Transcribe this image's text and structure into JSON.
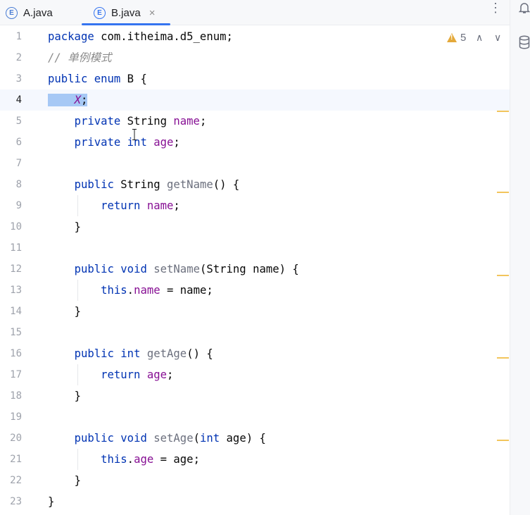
{
  "tabs": [
    {
      "label": "A.java",
      "icon": "E",
      "active": false
    },
    {
      "label": "B.java",
      "icon": "E",
      "active": true,
      "close": "×"
    }
  ],
  "toolbar": {
    "more": "⋮"
  },
  "inspections": {
    "warning_count": "5",
    "up": "∧",
    "down": "∨"
  },
  "sidebar": {
    "icons": [
      "bell-icon",
      "database-icon"
    ]
  },
  "colors": {
    "keyword": "#0033b3",
    "field": "#871094",
    "comment": "#8c8c8c",
    "selection": "#a6c8f5",
    "warning": "#e4a93a"
  },
  "editor": {
    "current_line": 4,
    "lines": [
      {
        "n": "1"
      },
      {
        "n": "2"
      },
      {
        "n": "3"
      },
      {
        "n": "4"
      },
      {
        "n": "5"
      },
      {
        "n": "6"
      },
      {
        "n": "7"
      },
      {
        "n": "8"
      },
      {
        "n": "9"
      },
      {
        "n": "10"
      },
      {
        "n": "11"
      },
      {
        "n": "12"
      },
      {
        "n": "13"
      },
      {
        "n": "14"
      },
      {
        "n": "15"
      },
      {
        "n": "16"
      },
      {
        "n": "17"
      },
      {
        "n": "18"
      },
      {
        "n": "19"
      },
      {
        "n": "20"
      },
      {
        "n": "21"
      },
      {
        "n": "22"
      },
      {
        "n": "23"
      }
    ],
    "code": {
      "l1a": "package",
      "l1b": " com.itheima.d5_enum;",
      "l2": "// 单例模式",
      "l3a": "public",
      "l3b": " ",
      "l3c": "enum",
      "l3d": " B {",
      "l4a": "X",
      "l4b": ";",
      "l5a": "private",
      "l5b": " String ",
      "l5c": "name",
      "l5d": ";",
      "l6a": "private",
      "l6b": " ",
      "l6c": "int",
      "l6d": " ",
      "l6e": "age",
      "l6f": ";",
      "l8a": "public",
      "l8b": " String ",
      "l8c": "getName",
      "l8d": "() {",
      "l9a": "return",
      "l9b": " ",
      "l9c": "name",
      "l9d": ";",
      "l10": "}",
      "l12a": "public",
      "l12b": " ",
      "l12c": "void",
      "l12d": " ",
      "l12e": "setName",
      "l12f": "(String name) {",
      "l13a": "this",
      "l13b": ".",
      "l13c": "name",
      "l13d": " = name;",
      "l14": "}",
      "l16a": "public",
      "l16b": " ",
      "l16c": "int",
      "l16d": " ",
      "l16e": "getAge",
      "l16f": "() {",
      "l17a": "return",
      "l17b": " ",
      "l17c": "age",
      "l17d": ";",
      "l18": "}",
      "l20a": "public",
      "l20b": " ",
      "l20c": "void",
      "l20d": " ",
      "l20e": "setAge",
      "l20f": "(",
      "l20g": "int",
      "l20h": " age) {",
      "l21a": "this",
      "l21b": ".",
      "l21c": "age",
      "l21d": " = age;",
      "l22": "}",
      "l23": "}"
    }
  }
}
